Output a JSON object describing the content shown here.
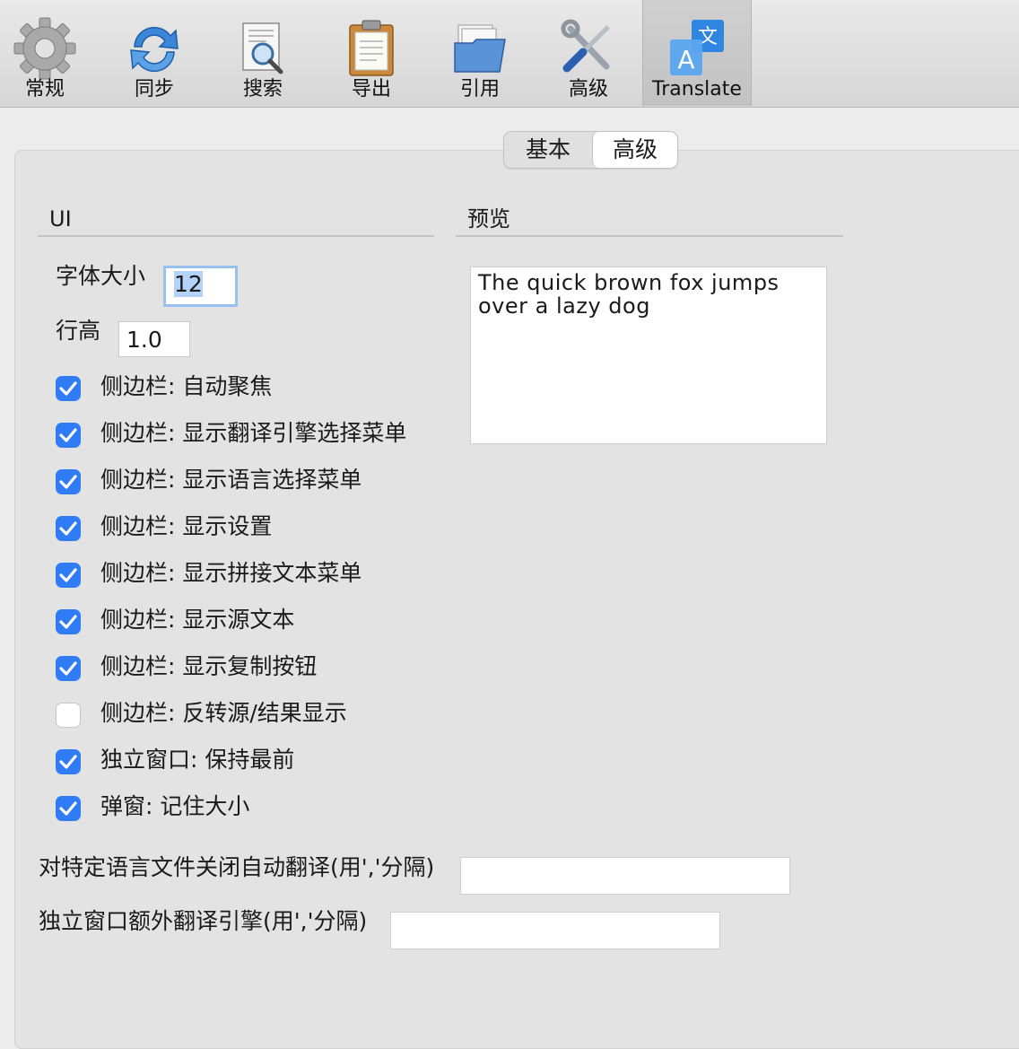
{
  "toolbar": {
    "items": [
      {
        "label": "常规",
        "icon": "gear-icon"
      },
      {
        "label": "同步",
        "icon": "sync-icon"
      },
      {
        "label": "搜索",
        "icon": "search-doc-icon"
      },
      {
        "label": "导出",
        "icon": "clipboard-icon"
      },
      {
        "label": "引用",
        "icon": "folder-icon"
      },
      {
        "label": "高级",
        "icon": "tools-icon"
      },
      {
        "label": "Translate",
        "icon": "translate-icon",
        "selected": true
      }
    ]
  },
  "tabs": {
    "basic": "基本",
    "advanced": "高级",
    "selected": "高级"
  },
  "ui_section": {
    "title": "UI",
    "font_size_label": "字体大小",
    "font_size_value": "12",
    "line_height_label": "行高",
    "line_height_value": "1.0",
    "checkboxes": [
      {
        "label": "侧边栏: 自动聚焦",
        "checked": true
      },
      {
        "label": "侧边栏: 显示翻译引擎选择菜单",
        "checked": true
      },
      {
        "label": "侧边栏: 显示语言选择菜单",
        "checked": true
      },
      {
        "label": "侧边栏: 显示设置",
        "checked": true
      },
      {
        "label": "侧边栏: 显示拼接文本菜单",
        "checked": true
      },
      {
        "label": "侧边栏: 显示源文本",
        "checked": true
      },
      {
        "label": "侧边栏: 显示复制按钮",
        "checked": true
      },
      {
        "label": "侧边栏: 反转源/结果显示",
        "checked": false
      },
      {
        "label": "独立窗口: 保持最前",
        "checked": true
      },
      {
        "label": "弹窗: 记住大小",
        "checked": true
      }
    ]
  },
  "preview_section": {
    "title": "预览",
    "text": "The quick brown fox jumps over a lazy dog"
  },
  "fields": {
    "disable_auto_translate_label": "对特定语言文件关闭自动翻译(用','分隔)",
    "disable_auto_translate_value": "",
    "extra_engines_label": "独立窗口额外翻译引擎(用','分隔)",
    "extra_engines_value": ""
  },
  "colors": {
    "checkbox_accent": "#2f7cf6",
    "focus_ring": "#9ac0ef"
  }
}
